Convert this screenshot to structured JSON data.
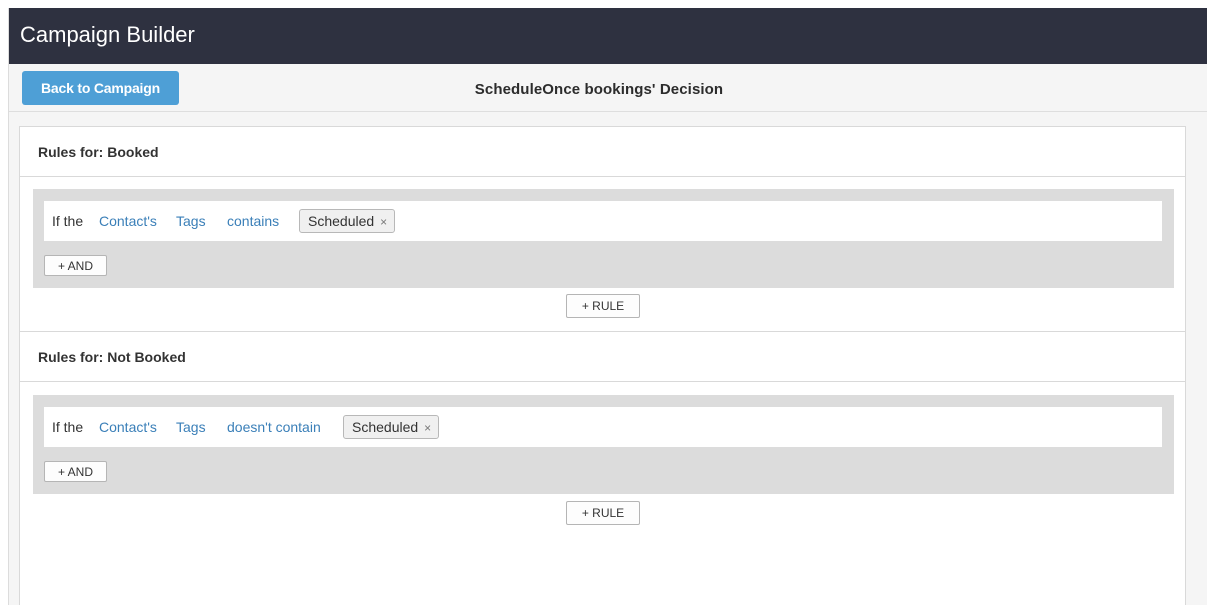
{
  "header": {
    "title": "Campaign Builder"
  },
  "toolbar": {
    "back_label": "Back to Campaign",
    "decision_title": "ScheduleOnce bookings' Decision"
  },
  "rule_groups": [
    {
      "label": "Rules for: Booked",
      "condition": {
        "prefix": "If the",
        "subject": "Contact's",
        "field": "Tags",
        "operator": "contains",
        "tag": "Scheduled",
        "remove_glyph": "×"
      },
      "and_label": "+ AND",
      "rule_label": "+ RULE"
    },
    {
      "label": "Rules for: Not Booked",
      "condition": {
        "prefix": "If the",
        "subject": "Contact's",
        "field": "Tags",
        "operator": "doesn't contain",
        "tag": "Scheduled",
        "remove_glyph": "×"
      },
      "and_label": "+ AND",
      "rule_label": "+ RULE"
    }
  ],
  "colors": {
    "titlebar": "#2e3140",
    "back_button": "#4e9fd6",
    "link": "#3a7fb8",
    "rule_box": "#dcdcdc"
  }
}
